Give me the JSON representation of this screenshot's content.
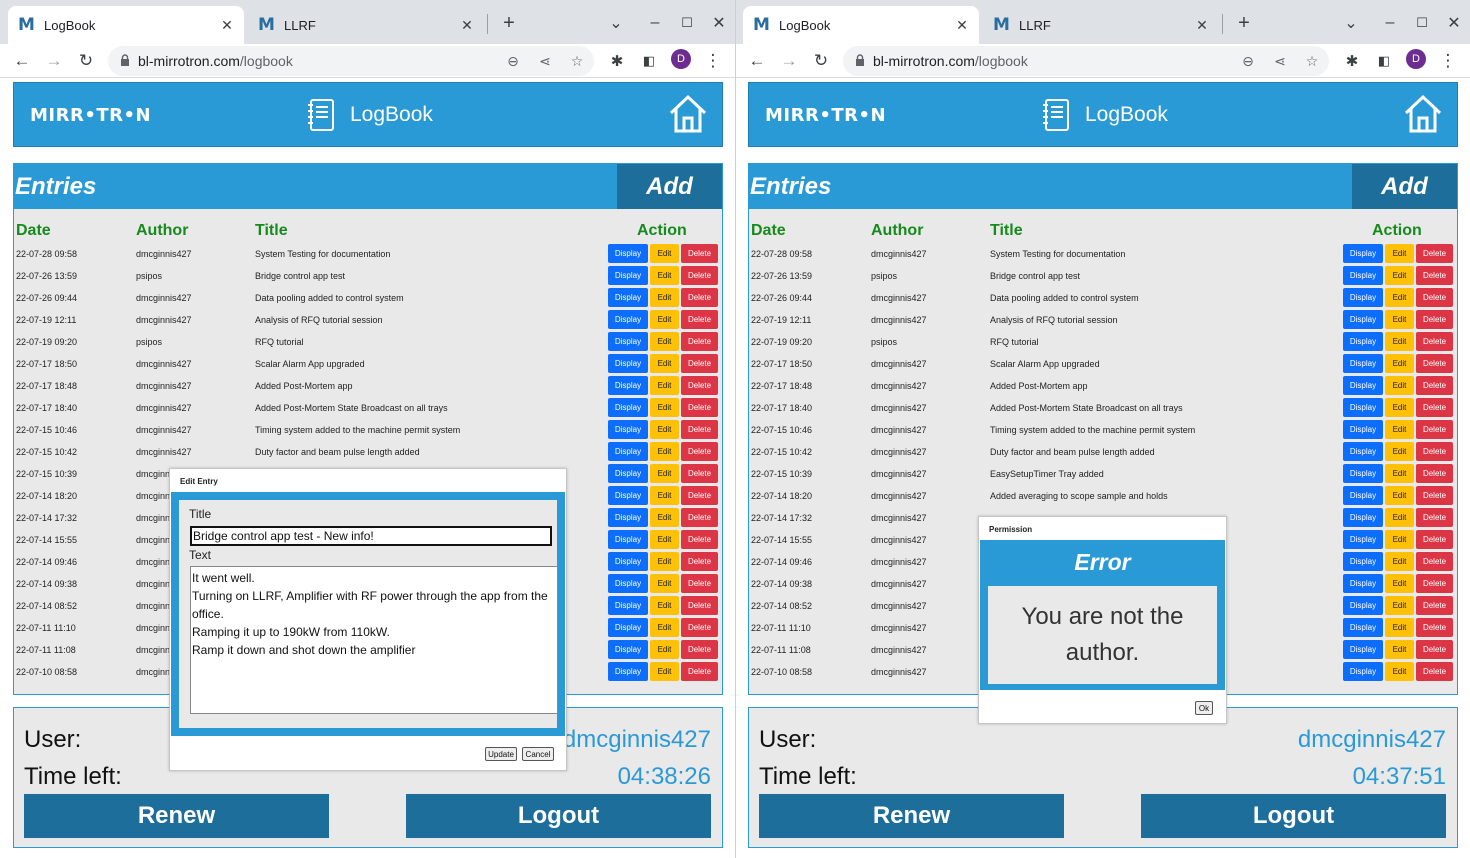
{
  "browser": {
    "tabs": [
      {
        "label": "LogBook",
        "favicon": "M"
      },
      {
        "label": "LLRF",
        "favicon": "M"
      }
    ],
    "new_tab": "+",
    "url_host": "bl-mirrotron.com",
    "url_path": "/logbook",
    "avatar_letter": "D"
  },
  "app": {
    "logo": "MIRR•TR•N",
    "title": "LogBook",
    "entries_title": "Entries",
    "add_label": "Add",
    "columns": {
      "date": "Date",
      "author": "Author",
      "title": "Title",
      "action": "Action"
    },
    "actions": {
      "display": "Display",
      "edit": "Edit",
      "delete": "Delete"
    },
    "user_label": "User:",
    "time_label": "Time left:",
    "renew_label": "Renew",
    "logout_label": "Logout"
  },
  "entries": [
    {
      "date": "22-07-28 09:58",
      "author": "dmcginnis427",
      "title": "System Testing for documentation"
    },
    {
      "date": "22-07-26 13:59",
      "author": "psipos",
      "title": "Bridge control app test"
    },
    {
      "date": "22-07-26 09:44",
      "author": "dmcginnis427",
      "title": "Data pooling added to control system"
    },
    {
      "date": "22-07-19 12:11",
      "author": "dmcginnis427",
      "title": "Analysis of RFQ tutorial session"
    },
    {
      "date": "22-07-19 09:20",
      "author": "psipos",
      "title": "RFQ tutorial"
    },
    {
      "date": "22-07-17 18:50",
      "author": "dmcginnis427",
      "title": "Scalar Alarm App upgraded"
    },
    {
      "date": "22-07-17 18:48",
      "author": "dmcginnis427",
      "title": "Added Post-Mortem app"
    },
    {
      "date": "22-07-17 18:40",
      "author": "dmcginnis427",
      "title": "Added Post-Mortem State Broadcast on all trays"
    },
    {
      "date": "22-07-15 10:46",
      "author": "dmcginnis427",
      "title": "Timing system added to the machine permit system"
    },
    {
      "date": "22-07-15 10:42",
      "author": "dmcginnis427",
      "title": "Duty factor and beam pulse length added"
    },
    {
      "date": "22-07-15 10:39",
      "author": "dmcginnis427",
      "title": "EasySetupTimer Tray added"
    },
    {
      "date": "22-07-14 18:20",
      "author": "dmcginnis427",
      "title": "Added averaging to scope sample and holds"
    },
    {
      "date": "22-07-14 17:32",
      "author": "dmcginnis427",
      "title": ""
    },
    {
      "date": "22-07-14 15:55",
      "author": "dmcginnis427",
      "title": ""
    },
    {
      "date": "22-07-14 09:46",
      "author": "dmcginnis427",
      "title": ""
    },
    {
      "date": "22-07-14 09:38",
      "author": "dmcginnis427",
      "title": ""
    },
    {
      "date": "22-07-14 08:52",
      "author": "dmcginnis427",
      "title": ""
    },
    {
      "date": "22-07-11 11:10",
      "author": "dmcginnis427",
      "title": ""
    },
    {
      "date": "22-07-11 11:08",
      "author": "dmcginnis427",
      "title": ""
    },
    {
      "date": "22-07-10 08:58",
      "author": "dmcginnis427",
      "title": ""
    }
  ],
  "left": {
    "user": "dmcginnis427",
    "time_left": "04:38:26",
    "edit_dialog": {
      "title": "Edit Entry",
      "title_label": "Title",
      "title_value": "Bridge control app test - New info!",
      "text_label": "Text",
      "text_lines": [
        "It went well.",
        "Turning on LLRF, Amplifier with RF power through the app from the office.",
        "Ramping it up to 190kW from 110kW.",
        "Ramp it down and shot down the amplifier"
      ],
      "update_label": "Update",
      "cancel_label": "Cancel"
    }
  },
  "right": {
    "user": "dmcginnis427",
    "time_left": "04:37:51",
    "error_dialog": {
      "title": "Permission",
      "header": "Error",
      "message": "You are not the author.",
      "ok_label": "Ok"
    }
  },
  "colors": {
    "brand_blue": "#2a9ad6",
    "dark_blue": "#1e6e9b",
    "header_green": "#178a1e",
    "display_btn": "#0d6efd",
    "edit_btn": "#ffc107",
    "delete_btn": "#dc3545"
  },
  "icons": [
    "back-icon",
    "forward-icon",
    "reload-icon",
    "lock-icon",
    "zoom-icon",
    "share-icon",
    "star-icon",
    "extensions-icon",
    "side-panel-icon",
    "menu-icon",
    "notebook-icon",
    "home-icon"
  ]
}
